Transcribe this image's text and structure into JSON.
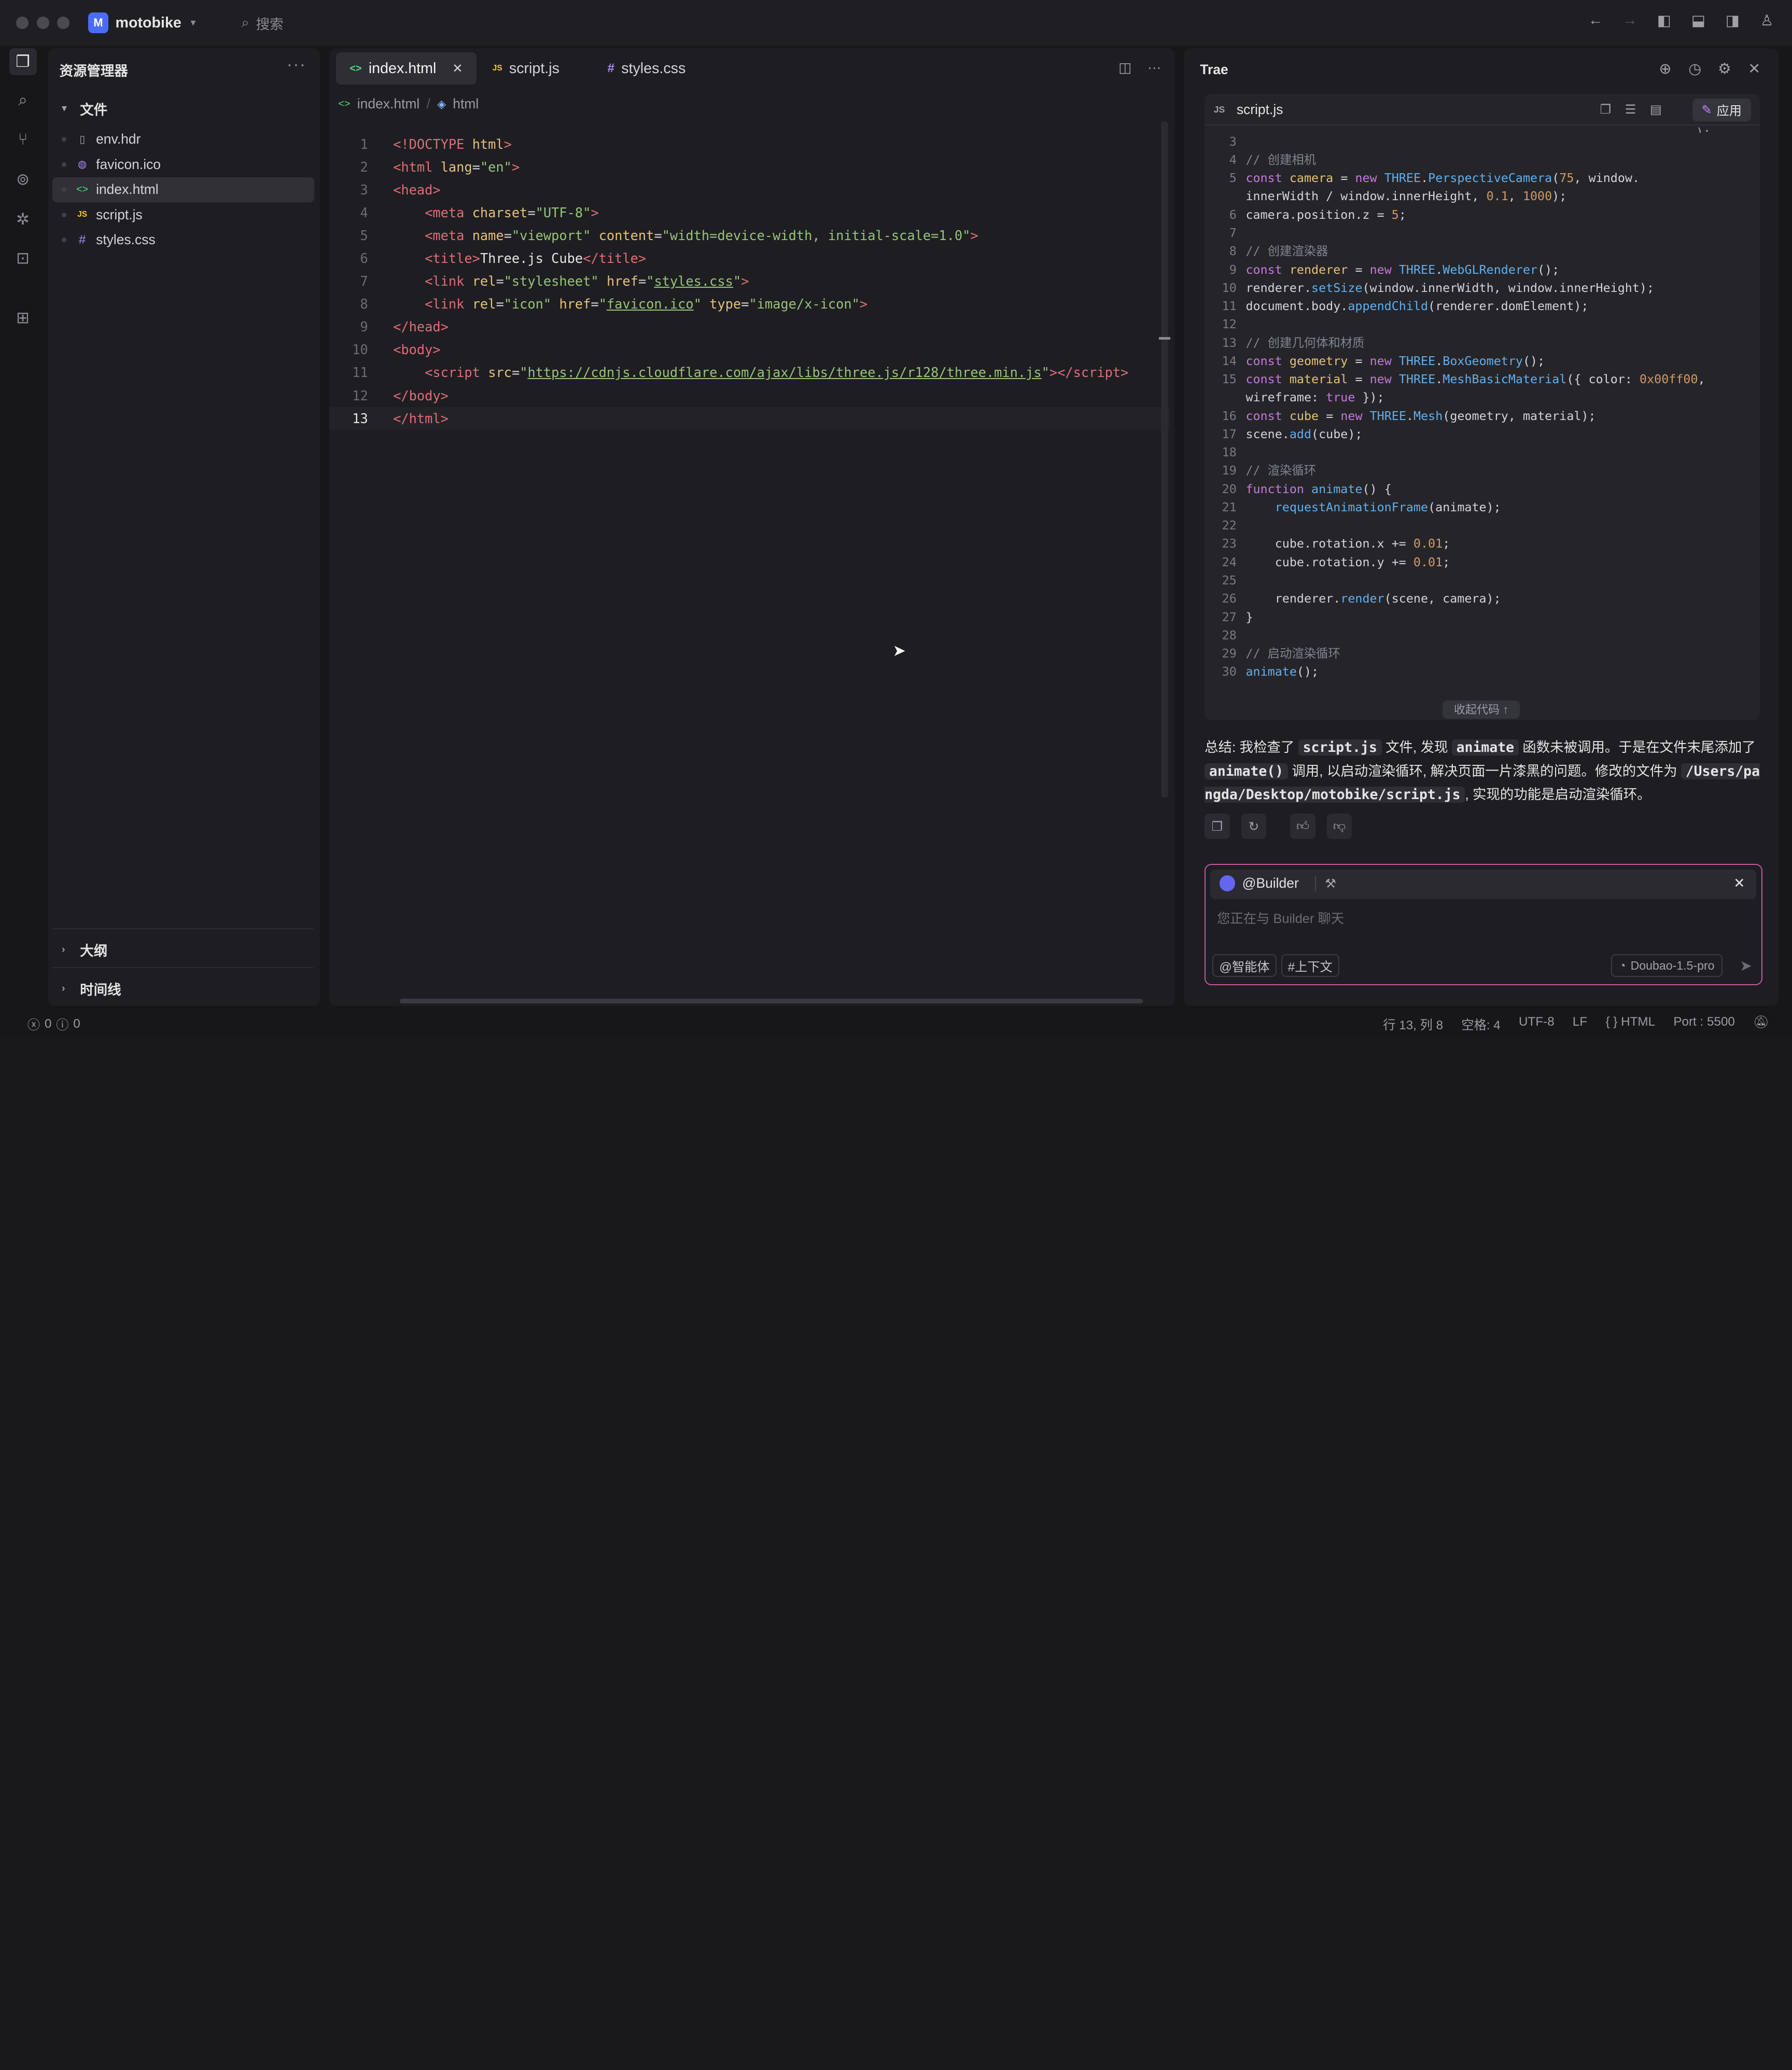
{
  "titlebar": {
    "project_initial": "M",
    "project_name": "motobike",
    "search_placeholder": "搜索"
  },
  "explorer": {
    "title": "资源管理器",
    "files_section": "文件",
    "files": [
      {
        "name": "env.hdr",
        "icon": "file-icon"
      },
      {
        "name": "favicon.ico",
        "icon": "favicon-icon"
      },
      {
        "name": "index.html",
        "icon": "html-icon"
      },
      {
        "name": "script.js",
        "icon": "js-icon"
      },
      {
        "name": "styles.css",
        "icon": "css-icon"
      }
    ],
    "outline_section": "大纲",
    "timeline_section": "时间线"
  },
  "editor": {
    "tabs": [
      {
        "label": "index.html",
        "icon_text": "<>",
        "active": true
      },
      {
        "label": "script.js",
        "icon_text": "JS",
        "active": false
      },
      {
        "label": "styles.css",
        "icon_text": "#",
        "active": false
      }
    ],
    "breadcrumb": [
      "index.html",
      "html"
    ],
    "current_line": 13
  },
  "trae": {
    "title": "Trae",
    "card_file": "script.js",
    "apply_label": "应用",
    "collapse_label": "收起代码 ↑",
    "summary": {
      "p1": "总结: 我检查了",
      "c1": "script.js",
      "p2": "文件, 发现",
      "c2": "animate",
      "p3": "函数未被调用。于是在文件末尾添加了",
      "c3": "animate()",
      "p4": "调用, 以启动渲染循环, 解决页面一片漆黑的问题。修改的文件为",
      "c4": "/Users/pangda/Desktop/motobike/script.js",
      "p5": ", 实现的功能是启动渲染循环。"
    },
    "chat": {
      "agent": "@Builder",
      "placeholder": "您正在与 Builder 聊天",
      "chip_agent": "@智能体",
      "chip_context": "#上下文",
      "model": "Doubao-1.5-pro"
    }
  },
  "status": {
    "errors": "0",
    "warnings": "0",
    "position": "行 13, 列 8",
    "indent": "空格: 4",
    "encoding": "UTF-8",
    "eol": "LF",
    "language": "{ } HTML",
    "port": "Port : 5500"
  }
}
